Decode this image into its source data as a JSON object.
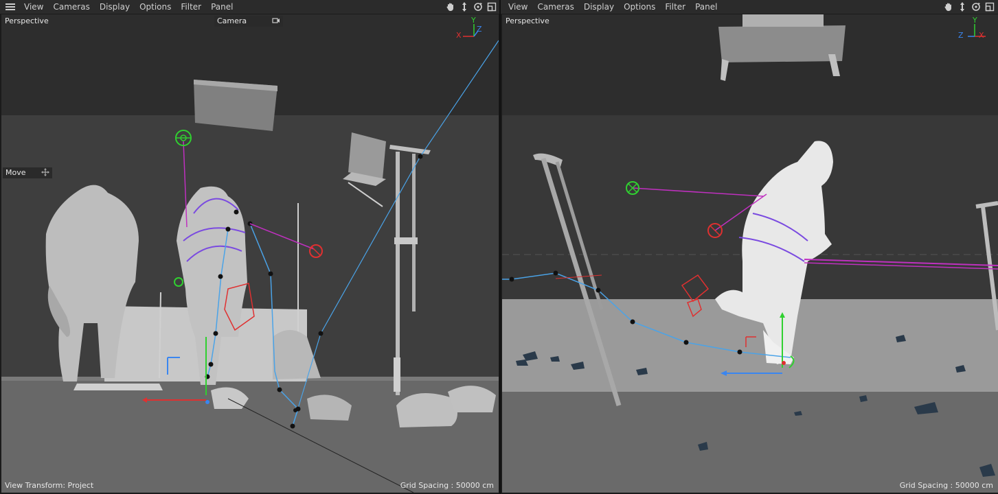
{
  "menu": {
    "items": [
      "View",
      "Cameras",
      "Display",
      "Options",
      "Filter",
      "Panel"
    ]
  },
  "left_viewport": {
    "projection": "Perspective",
    "camera_label": "Camera",
    "tool_label": "Move",
    "view_transform": "View Transform: Project",
    "grid_spacing": "Grid Spacing : 50000 cm",
    "axes": {
      "x": "X",
      "y": "Y",
      "z": "Z"
    }
  },
  "right_viewport": {
    "projection": "Perspective",
    "grid_spacing": "Grid Spacing : 50000 cm",
    "axes": {
      "x": "X",
      "y": "Y",
      "z": "Z"
    }
  },
  "nav_icons": [
    "pan-hand-icon",
    "dolly-arrows-icon",
    "orbit-icon",
    "maximize-panel-icon"
  ],
  "colors": {
    "menubar": "#2b2b2b",
    "floor": "#6a6a6a",
    "wall": "#3a3a3a",
    "path_blue": "#4aa3e8",
    "magenta": "#c030c0",
    "green": "#30d030",
    "red": "#e03030"
  }
}
